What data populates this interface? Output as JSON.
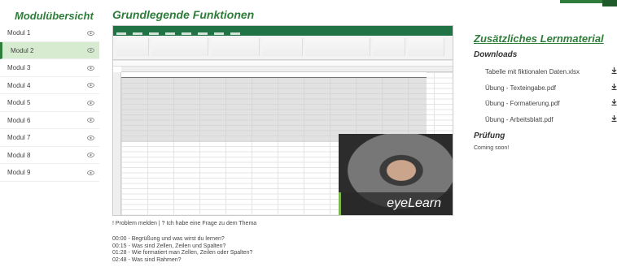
{
  "sidebar": {
    "title": "Modulübersicht",
    "modules": [
      {
        "label": "Modul 1"
      },
      {
        "label": "Modul 2"
      },
      {
        "label": "Modul 3"
      },
      {
        "label": "Modul 4"
      },
      {
        "label": "Modul 5"
      },
      {
        "label": "Modul 6"
      },
      {
        "label": "Modul 7"
      },
      {
        "label": "Modul 8"
      },
      {
        "label": "Modul 9"
      }
    ],
    "active_index": 1
  },
  "main": {
    "title": "Grundlegende Funktionen",
    "video_brand": "eyeLearn",
    "report_text": "! Problem melden | ? Ich habe eine Frage zu dem Thema",
    "chapters": [
      "00:00 - Begrüßung und was wirst du lernen?",
      "00:15 - Was sind Zellen, Zeilen und Spalten?",
      "01:28 - Wie formatiert man Zellen, Zeilen oder Spalten?",
      "02:48 - Was sind Rahmen?"
    ]
  },
  "aside": {
    "title": "Zusätzliches Lernmaterial",
    "downloads_title": "Downloads",
    "downloads": [
      {
        "label": "Tabelle mit fiktionalen Daten.xlsx",
        "icon": "download-icon"
      },
      {
        "label": "Übung - Texteingabe.pdf",
        "icon": "download-icon"
      },
      {
        "label": "Übung - Formatierung.pdf",
        "icon": "download-icon"
      },
      {
        "label": "Übung - Arbeitsblatt.pdf",
        "icon": "download-icon"
      }
    ],
    "pruefung_title": "Prüfung",
    "pruefung_text": "Coming soon!"
  },
  "colors": {
    "accent": "#2e7d3a",
    "active_bg": "#d6ebcf",
    "excel": "#217346"
  }
}
